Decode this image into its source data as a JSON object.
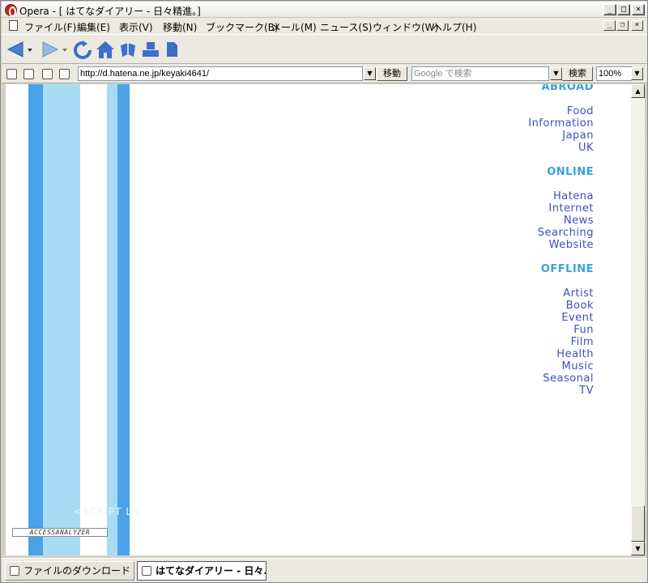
{
  "window": {
    "title": "Opera - [ はてなダイアリー - 日々精進。]",
    "controls": {
      "minimize": "_",
      "maximize": "□",
      "close": "×"
    },
    "mdi_controls": {
      "minimize": "_",
      "restore": "❐",
      "close": "×"
    }
  },
  "menubar": {
    "items": [
      {
        "label": "ファイル(F)"
      },
      {
        "label": "編集(E)"
      },
      {
        "label": "表示(V)"
      },
      {
        "label": "移動(N)"
      },
      {
        "label": "ブックマーク(B)"
      },
      {
        "label": "メール(M)"
      },
      {
        "label": "ニュース(S)"
      },
      {
        "label": "ウィンドウ(W)"
      },
      {
        "label": "ヘルプ(H)"
      }
    ]
  },
  "toolbar": {
    "icons": [
      "back-icon",
      "back-dropdown-icon",
      "forward-icon",
      "forward-dropdown-icon",
      "reload-icon",
      "home-icon",
      "hotlist-icon",
      "print-icon",
      "new-page-icon"
    ]
  },
  "addressbar": {
    "url": "http://d.hatena.ne.jp/keyaki4641/",
    "go_label": "移動",
    "search_placeholder": "Google で検索",
    "search_label": "検索",
    "zoom": "100%"
  },
  "page": {
    "sections": [
      {
        "heading": "ABROAD",
        "links": [
          "Food",
          "Information",
          "Japan",
          "UK"
        ]
      },
      {
        "heading": "ONLINE",
        "links": [
          "Hatena",
          "Internet",
          "News",
          "Searching",
          "Website"
        ]
      },
      {
        "heading": "OFFLINE",
        "links": [
          "Artist",
          "Book",
          "Event",
          "Fun",
          "Film",
          "Health",
          "Music",
          "Seasonal",
          "TV"
        ]
      }
    ],
    "script_text": "<SCRIPT LA",
    "access_analyzer": "ACCESSANALYZER",
    "colors": {
      "stripe_dark": "#4aa3e6",
      "stripe_light": "#a8dcf5",
      "heading": "#3aa0dc",
      "link": "#3d4fc0"
    }
  },
  "tabs": [
    {
      "label": "ファイルのダウンロード",
      "active": false
    },
    {
      "label": "はてなダイアリー - 日々...",
      "active": true
    }
  ]
}
